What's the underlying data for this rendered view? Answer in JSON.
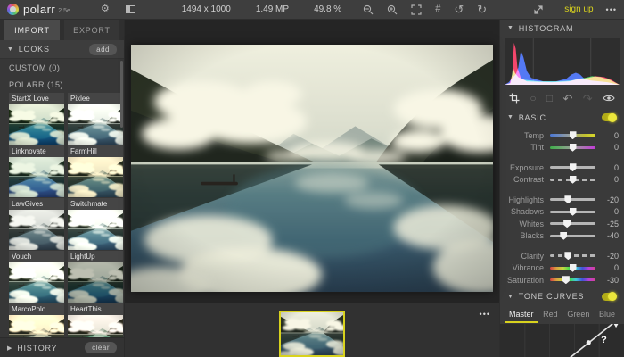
{
  "topbar": {
    "app_name": "polarr",
    "version": "2.5e",
    "image_dimensions": "1494 x 1000",
    "image_megapixels": "1.49 MP",
    "zoom_level": "49.8 %",
    "signup_label": "sign up",
    "more_glyph": "•••"
  },
  "left_panel": {
    "import_tab": "IMPORT",
    "export_tab": "EXPORT",
    "looks_header": "LOOKS",
    "add_button": "add",
    "custom_group": "CUSTOM (0)",
    "polarr_group": "POLARR (15)",
    "looks": [
      "StartX Love",
      "Pixlee",
      "Linknovate",
      "FarmHill",
      "LawGives",
      "Switchmate",
      "Vouch",
      "LightUp",
      "MarcoPolo",
      "HeartThis"
    ],
    "history_header": "HISTORY",
    "clear_button": "clear"
  },
  "right_panel": {
    "histogram_header": "HISTOGRAM",
    "basic_header": "BASIC",
    "sliders": [
      {
        "label": "Temp",
        "value": 0,
        "track": "temp",
        "gap": false
      },
      {
        "label": "Tint",
        "value": 0,
        "track": "tint",
        "gap": true
      },
      {
        "label": "Exposure",
        "value": 0,
        "track": "plain",
        "gap": false
      },
      {
        "label": "Contrast",
        "value": 0,
        "track": "dashed",
        "gap": true
      },
      {
        "label": "Highlights",
        "value": -20,
        "track": "plain",
        "gap": false
      },
      {
        "label": "Shadows",
        "value": 0,
        "track": "plain",
        "gap": false
      },
      {
        "label": "Whites",
        "value": -25,
        "track": "plain",
        "gap": false
      },
      {
        "label": "Blacks",
        "value": -40,
        "track": "plain",
        "gap": true
      },
      {
        "label": "Clarity",
        "value": -20,
        "track": "dashed",
        "gap": false
      },
      {
        "label": "Vibrance",
        "value": 0,
        "track": "rainbow",
        "gap": false
      },
      {
        "label": "Saturation",
        "value": -30,
        "track": "rainbow",
        "gap": false
      }
    ],
    "tone_curves_header": "TONE CURVES",
    "curve_tabs": [
      "Master",
      "Red",
      "Green",
      "Blue"
    ],
    "active_curve_tab": "Master",
    "curve_help_glyph": "?"
  },
  "glyphs": {
    "collapse": "▼",
    "expand": "▶",
    "gear": "⚙",
    "rotate_ccw": "↺",
    "rotate_cw": "↻",
    "undo": "↶",
    "redo": "↷",
    "circle_tool": "○",
    "rect_tool": "□",
    "grid": "#"
  },
  "colors": {
    "accent": "#d8d21e",
    "panel": "#3a3a3a",
    "canvas": "#252525"
  }
}
